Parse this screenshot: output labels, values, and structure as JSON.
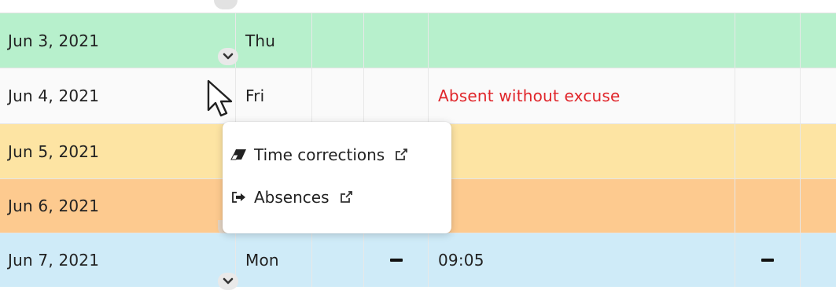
{
  "rows": [
    {
      "date": "Jun 3, 2021",
      "day": "Thu",
      "note": "",
      "col_b": "",
      "col_e": "",
      "bg": "#b7f0cc"
    },
    {
      "date": "Jun 4, 2021",
      "day": "Fri",
      "note": "Absent without excuse",
      "col_b": "",
      "col_e": "",
      "bg": "#fafafa"
    },
    {
      "date": "Jun 5, 2021",
      "day": "",
      "note": "",
      "col_b": "",
      "col_e": "",
      "bg": "#fde4a3"
    },
    {
      "date": "Jun 6, 2021",
      "day": "",
      "note": "",
      "col_b": "",
      "col_e": "",
      "bg": "#fdca8f"
    },
    {
      "date": "Jun 7, 2021",
      "day": "Mon",
      "note": "09:05",
      "col_b": "–",
      "col_e": "–",
      "bg": "#cfebf8"
    }
  ],
  "context_menu": {
    "items": [
      {
        "label": "Time corrections",
        "icon": "eraser-icon"
      },
      {
        "label": "Absences",
        "icon": "sign-out-icon"
      }
    ]
  },
  "colors": {
    "absent_text": "#e0262b"
  }
}
